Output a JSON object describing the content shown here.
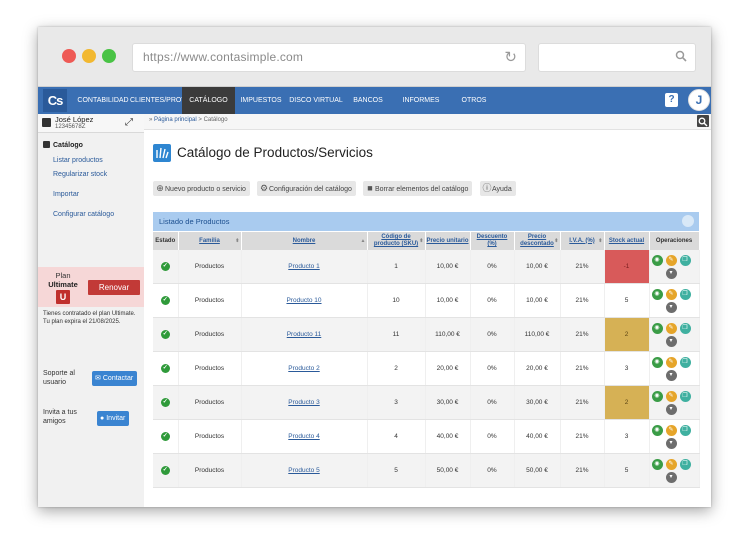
{
  "browser": {
    "url": "https://www.contasimple.com"
  },
  "app": {
    "logo": "Cs",
    "nav": [
      {
        "label": "CONTABILIDAD"
      },
      {
        "label": "CLIENTES/PROV."
      },
      {
        "label": "CATÁLOGO"
      },
      {
        "label": "IMPUESTOS"
      },
      {
        "label": "DISCO VIRTUAL"
      },
      {
        "label": "BANCOS"
      },
      {
        "label": "INFORMES"
      },
      {
        "label": "OTROS"
      }
    ],
    "active_nav": "CATÁLOGO",
    "help": "?",
    "avatar_initial": "J",
    "accent_color": "#3a6fb3"
  },
  "sidebar": {
    "user_name": "José López",
    "user_id": "12345678Z",
    "section": "Catálogo",
    "links": {
      "listar": "Listar productos",
      "regularizar": "Regularizar stock",
      "importar": "Importar",
      "configurar": "Configurar catálogo"
    },
    "plan": {
      "label": "Plan",
      "name": "Ultimate",
      "badge": "U",
      "renew": "Renovar",
      "note": "Tienes contratado el plan Ultimate. Tu plan expira el 21/08/2025."
    },
    "support": {
      "label": "Soporte al usuario",
      "button": "Contactar"
    },
    "invite": {
      "label": "Invita a tus amigos",
      "button": "Invitar"
    }
  },
  "breadcrumb": {
    "home": "Página principal",
    "separator": ">",
    "current": "Catálogo"
  },
  "page": {
    "title": "Catálogo de Productos/Servicios"
  },
  "toolbar": {
    "new": "Nuevo producto o servicio",
    "config": "Configuración del catálogo",
    "delete": "Borrar elementos del catálogo",
    "help": "Ayuda"
  },
  "list": {
    "title": "Listado de Productos",
    "columns": {
      "estado": "Estado",
      "familia": "Familia",
      "nombre": "Nombre",
      "sku": "Código de producto (SKU)",
      "precio": "Precio unitario",
      "descuento": "Descuento (%)",
      "precio_desc": "Precio descontado",
      "iva": "I.V.A. (%)",
      "stock": "Stock actual",
      "ops": "Operaciones"
    },
    "rows": [
      {
        "familia": "Productos",
        "nombre": "Producto 1",
        "sku": "1",
        "precio": "10,00 €",
        "descuento": "0%",
        "precio_desc": "10,00 €",
        "iva": "21%",
        "stock": "-1",
        "stock_state": "red"
      },
      {
        "familia": "Productos",
        "nombre": "Producto 10",
        "sku": "10",
        "precio": "10,00 €",
        "descuento": "0%",
        "precio_desc": "10,00 €",
        "iva": "21%",
        "stock": "5",
        "stock_state": "ok"
      },
      {
        "familia": "Productos",
        "nombre": "Producto 11",
        "sku": "11",
        "precio": "110,00 €",
        "descuento": "0%",
        "precio_desc": "110,00 €",
        "iva": "21%",
        "stock": "2",
        "stock_state": "amber"
      },
      {
        "familia": "Productos",
        "nombre": "Producto 2",
        "sku": "2",
        "precio": "20,00 €",
        "descuento": "0%",
        "precio_desc": "20,00 €",
        "iva": "21%",
        "stock": "3",
        "stock_state": "ok"
      },
      {
        "familia": "Productos",
        "nombre": "Producto 3",
        "sku": "3",
        "precio": "30,00 €",
        "descuento": "0%",
        "precio_desc": "30,00 €",
        "iva": "21%",
        "stock": "2",
        "stock_state": "amber"
      },
      {
        "familia": "Productos",
        "nombre": "Producto 4",
        "sku": "4",
        "precio": "40,00 €",
        "descuento": "0%",
        "precio_desc": "40,00 €",
        "iva": "21%",
        "stock": "3",
        "stock_state": "ok"
      },
      {
        "familia": "Productos",
        "nombre": "Producto 5",
        "sku": "5",
        "precio": "50,00 €",
        "descuento": "0%",
        "precio_desc": "50,00 €",
        "iva": "21%",
        "stock": "5",
        "stock_state": "ok"
      }
    ]
  }
}
